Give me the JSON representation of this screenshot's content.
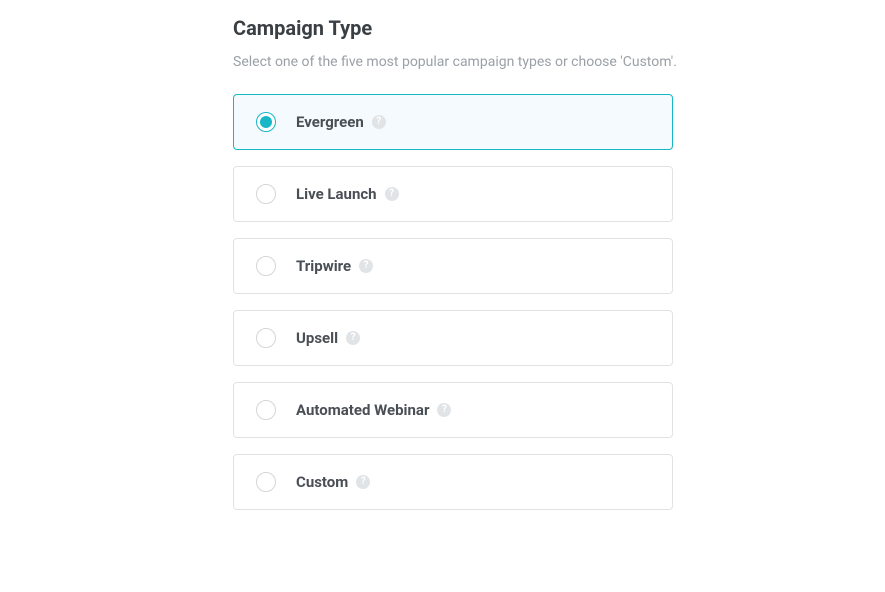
{
  "heading": "Campaign Type",
  "description": "Select one of the five most popular campaign types or choose 'Custom'.",
  "options": [
    {
      "label": "Evergreen",
      "selected": true
    },
    {
      "label": "Live Launch",
      "selected": false
    },
    {
      "label": "Tripwire",
      "selected": false
    },
    {
      "label": "Upsell",
      "selected": false
    },
    {
      "label": "Automated Webinar",
      "selected": false
    },
    {
      "label": "Custom",
      "selected": false
    }
  ],
  "colors": {
    "accent": "#17b8c5",
    "selected_bg": "#f4fafd",
    "border": "#dfe3e6",
    "text_primary": "#3a3f44",
    "text_secondary": "#9aa0a6"
  }
}
